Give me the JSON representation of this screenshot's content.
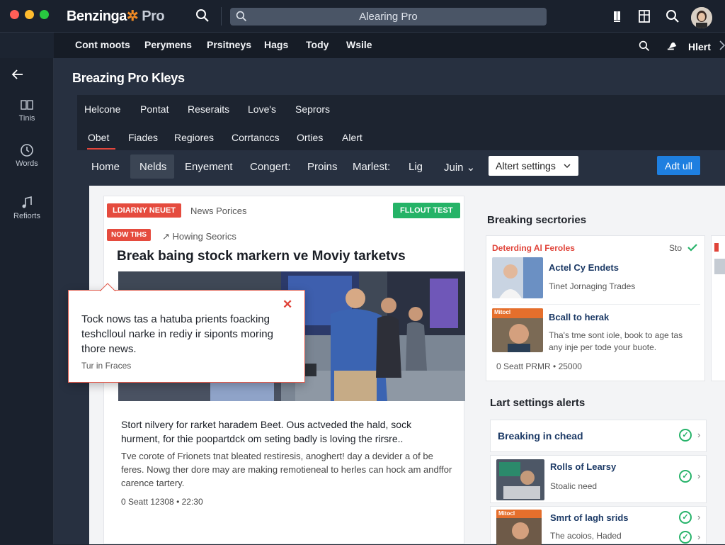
{
  "app": {
    "brand_main": "Benzinga",
    "brand_star": "✲",
    "brand_pro": " Pro"
  },
  "search": {
    "value": "Alearing Pro"
  },
  "topnav": {
    "items": [
      "Cont moots",
      "Perymens",
      "Prsitneys",
      "Hags",
      "Tody",
      "Wsile"
    ],
    "alert_label": "Hlert"
  },
  "sidebar": {
    "items": [
      {
        "icon": "book-icon",
        "label": "Tinis"
      },
      {
        "icon": "clock-icon",
        "label": "Words"
      },
      {
        "icon": "music-icon",
        "label": "Refiorts"
      }
    ]
  },
  "page": {
    "title": "Breazing Pro Kleys"
  },
  "nav1": {
    "items": [
      "Helcone",
      "Pontat",
      "Reseraits",
      "Love's",
      "Seprors"
    ]
  },
  "nav2": {
    "items": [
      "Obet",
      "Fiades",
      "Regiores",
      "Corrtanccs",
      "Orties",
      "Alert"
    ]
  },
  "nav3": {
    "items": [
      "Home",
      "Nelds",
      "Enyement",
      "Congert:",
      "Proins",
      "Marlest:",
      "Lig",
      "Juin ⌄"
    ],
    "alert_settings": "Altert settings",
    "add_button": "Adt ull"
  },
  "main_card": {
    "badge1": "LDIARNY NEUET",
    "label1": "News Porices",
    "badge_green": "FLLOUT TEST",
    "badge2": "NOW TIHS",
    "label2": "↗ Howing Seorics",
    "headline": "Break baing stock markern ve Moviy tarketvs",
    "body1": "Stort nilvery for rarket haradem Beet. Ous actveded the hald, sock hurment, for thie poopartdck om seting badly is loving the rirsre..",
    "body2": "Tve corote of Frionets tnat bleated restiresis, anoghert! day a devider a of be feres. Nowg ther dore may are making remotieneal to herles can hock am andffor carence tartery.",
    "meta": "0 Seatt 12308  •  22:30"
  },
  "popup": {
    "text": "Tock nows tas a hatuba prients foacking teshclloul narke in rediy ir siponts moring thore news.",
    "sub": "Tur in Fraces",
    "close": "✕"
  },
  "right": {
    "title1": "Breaking secrtories",
    "red_label": "Deterding Al Feroles",
    "small_label": "Sto",
    "item1": {
      "title": "Actel Cy Endets",
      "sub": "Tinet Jornaging Trades"
    },
    "item2": {
      "title": "Bcall to herak",
      "sub": "Tha's tme sont iole, book to age tas any inje per tode your buote.",
      "thumb_tag": "Mitocl"
    },
    "meta": "0 Seatt PRMR  •  25000",
    "title2": "Lart settings alerts",
    "alert1": "Breaking in chead",
    "alert2": {
      "title": "Rolls of Learsy",
      "sub": "Stoalic need"
    },
    "alert3": {
      "title": "Smrt of lagh srids",
      "sub": "The acoios, Haded",
      "thumb_tag": "Mitocl"
    }
  },
  "colors": {
    "accent": "#1e7fe0",
    "red": "#e54b3e",
    "green": "#25b367",
    "brand_star": "#f08a24"
  }
}
